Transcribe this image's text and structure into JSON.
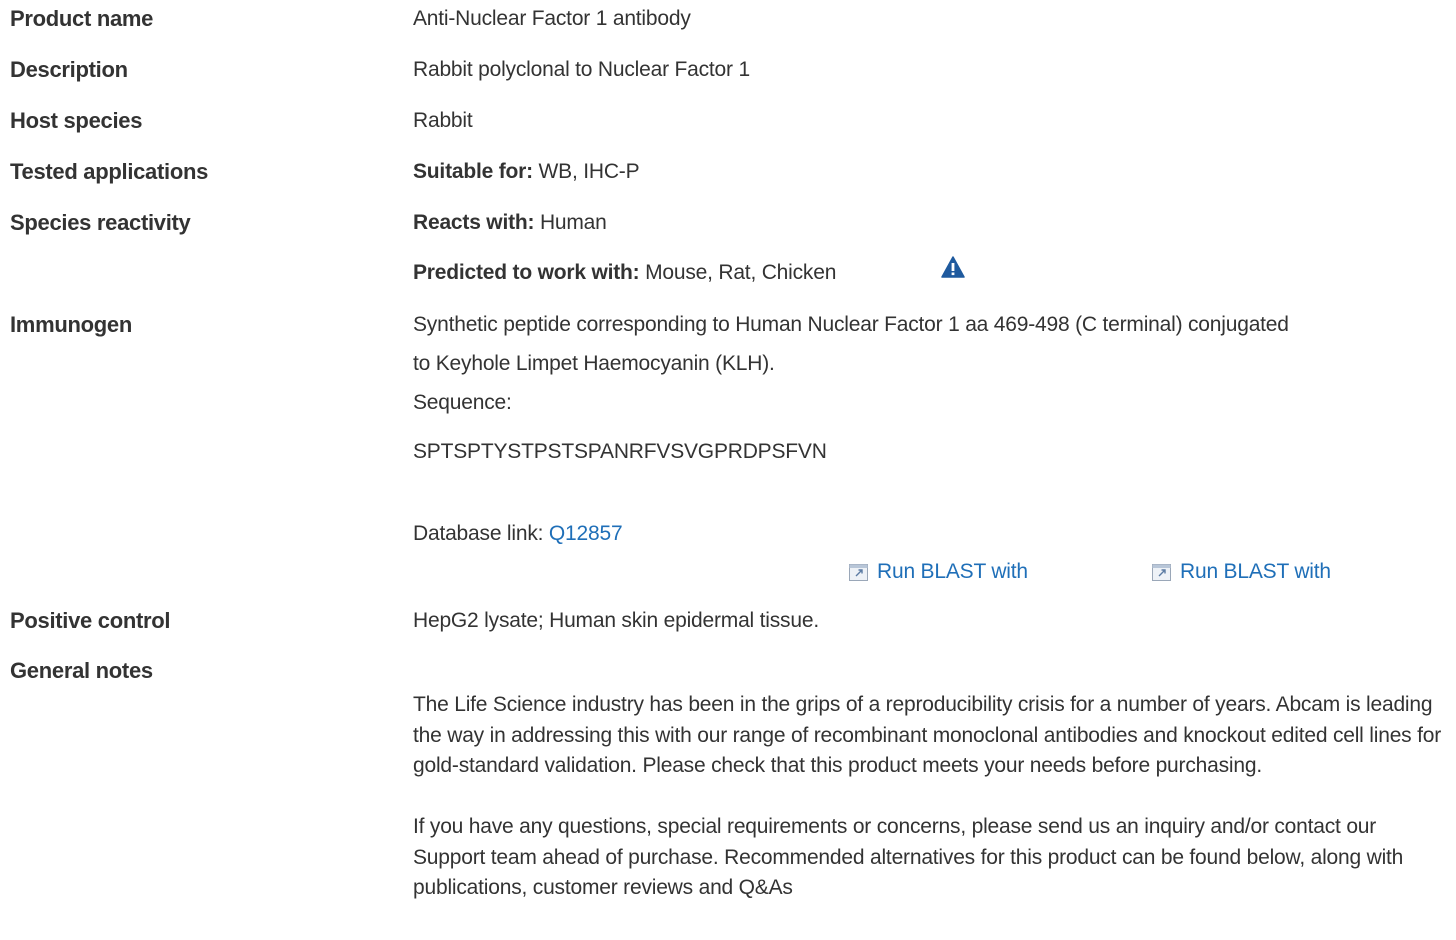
{
  "rows": {
    "product_name": {
      "label": "Product name",
      "value": "Anti-Nuclear Factor 1 antibody"
    },
    "description": {
      "label": "Description",
      "value": "Rabbit polyclonal to Nuclear Factor 1"
    },
    "host_species": {
      "label": "Host species",
      "value": "Rabbit"
    },
    "tested_applications": {
      "label": "Tested applications",
      "prefix": "Suitable for:",
      "value": "WB, IHC-P"
    },
    "species_reactivity": {
      "label": "Species reactivity",
      "reacts_prefix": "Reacts with:",
      "reacts_value": "Human",
      "predicted_prefix": "Predicted to work with:",
      "predicted_value": "Mouse, Rat, Chicken"
    },
    "immunogen": {
      "label": "Immunogen",
      "line1": "Synthetic peptide corresponding to Human Nuclear Factor 1 aa 469-498 (C terminal) conjugated",
      "line2": "to Keyhole Limpet Haemocyanin (KLH).",
      "sequence_label": "Sequence:",
      "sequence": "SPTSPTYSTPSTSPANRFVSVGPRDPSFVN",
      "database_prefix": "Database link:",
      "database_link": "Q12857",
      "blast_1": "Run BLAST with",
      "blast_2": "Run BLAST with"
    },
    "positive_control": {
      "label": "Positive control",
      "value": "HepG2 lysate; Human skin epidermal tissue."
    },
    "general_notes": {
      "label": "General notes",
      "paragraph1": "The Life Science industry has been in the grips of a reproducibility crisis for a number of years. Abcam is leading the way in addressing this with our range of recombinant monoclonal antibodies and knockout edited cell lines for gold-standard validation. Please check that this product meets your needs before purchasing.",
      "paragraph2": "If you have any questions, special requirements or concerns, please send us an inquiry and/or contact our Support team ahead of purchase. Recommended alternatives for this product can be found below, along with publications, customer reviews and Q&As"
    }
  },
  "icons": {
    "warning": "warning-triangle-icon",
    "external": "external-link-icon"
  },
  "colors": {
    "text": "#333333",
    "link": "#1f6fb8",
    "warning": "#1f5a9e"
  }
}
